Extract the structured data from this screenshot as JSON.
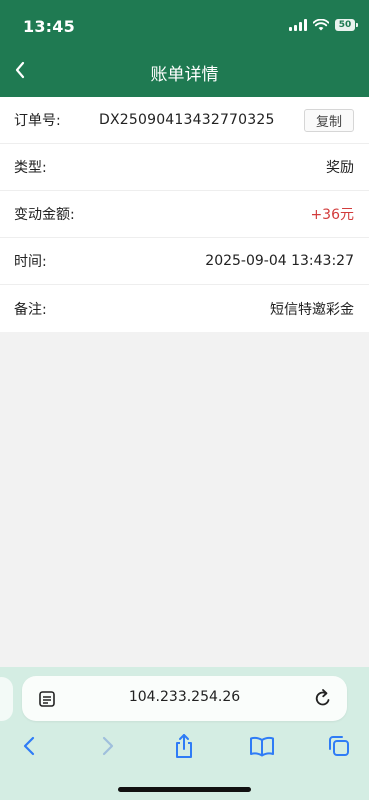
{
  "status": {
    "time": "13:45",
    "battery": "50"
  },
  "nav": {
    "title": "账单详情"
  },
  "detail": {
    "order_label": "订单号:",
    "order_no": "DX25090413432770325",
    "copy_label": "复制",
    "type_label": "类型:",
    "type_value": "奖励",
    "amount_label": "变动金额:",
    "amount_value": "+36元",
    "time_label": "时间:",
    "time_value": "2025-09-04 13:43:27",
    "note_label": "备注:",
    "note_value": "短信特邀彩金"
  },
  "browser": {
    "url": "104.233.254.26"
  },
  "colors": {
    "header_green": "#1f7a52",
    "amount_red": "#d23c3c",
    "safari_bar": "#d4ede3",
    "toolbar_blue": "#2f7cf6"
  },
  "icons": [
    "back-chevron-icon",
    "reader-icon",
    "reload-icon",
    "back-arrow-icon",
    "forward-arrow-icon",
    "share-icon",
    "bookmarks-icon",
    "tabs-icon"
  ]
}
